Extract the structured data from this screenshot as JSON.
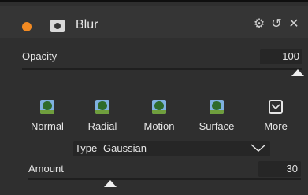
{
  "header": {
    "title": "Blur",
    "status_color": "#f28a22",
    "icons": [
      "gear-icon",
      "undo-icon",
      "close-icon"
    ],
    "gear_glyph": "⚙",
    "undo_glyph": "↺",
    "close_glyph": "✕"
  },
  "opacity": {
    "label": "Opacity",
    "value": "100",
    "level": 1.0
  },
  "presets": {
    "items": [
      {
        "label": "Normal"
      },
      {
        "label": "Radial"
      },
      {
        "label": "Motion"
      },
      {
        "label": "Surface"
      },
      {
        "label": "More"
      }
    ]
  },
  "type_select": {
    "label": "Type",
    "value": "Gaussian"
  },
  "amount": {
    "label": "Amount",
    "value": "30",
    "level": 0.3
  }
}
